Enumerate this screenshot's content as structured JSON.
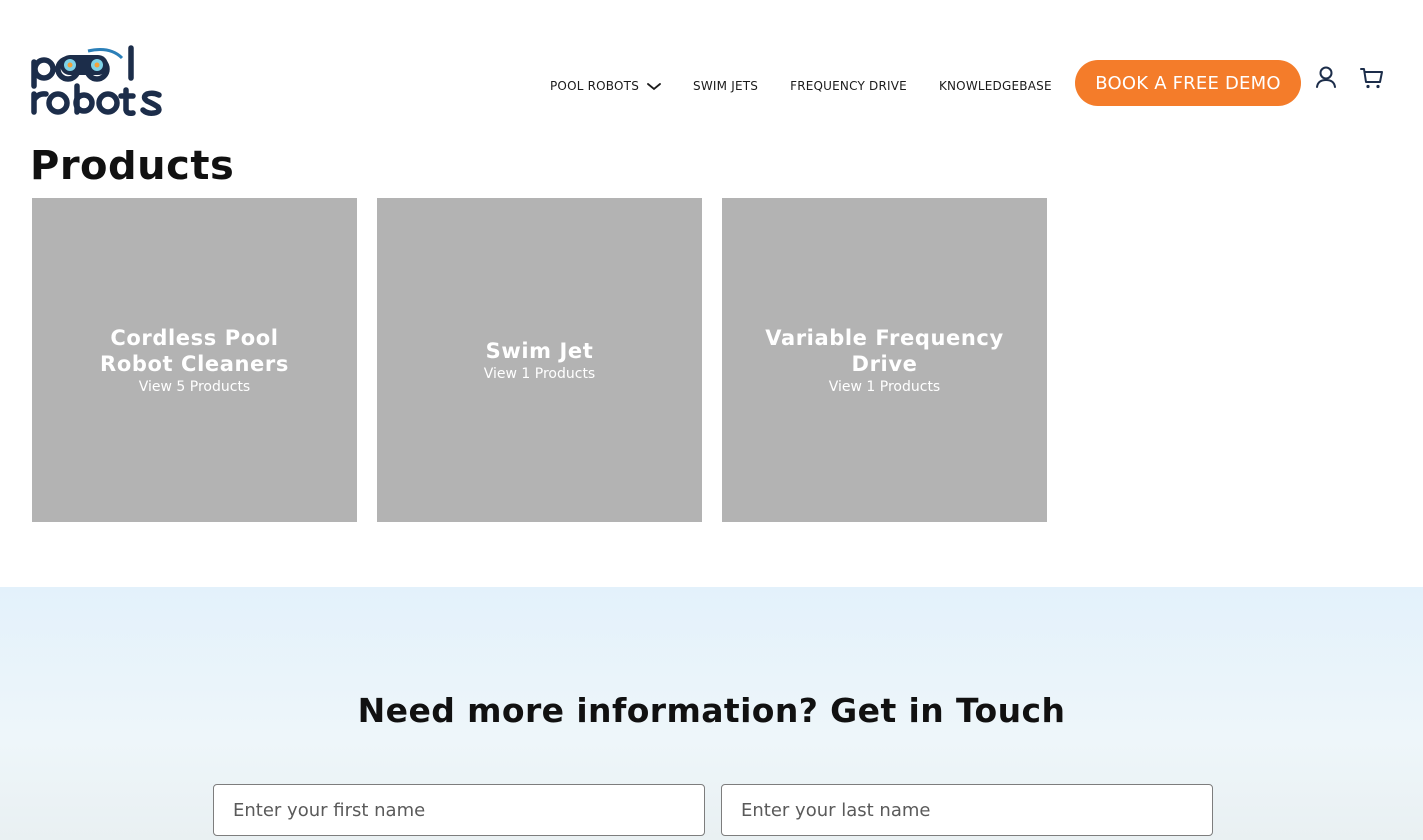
{
  "header": {
    "logo_text": "pool robots",
    "nav": [
      {
        "label": "POOL ROBOTS",
        "has_dropdown": true
      },
      {
        "label": "SWIM JETS"
      },
      {
        "label": "FREQUENCY DRIVE"
      },
      {
        "label": "KNOWLEDGEBASE"
      }
    ],
    "demo_button": "BOOK A FREE DEMO",
    "icons": [
      "account-icon",
      "cart-icon"
    ]
  },
  "page": {
    "title": "Products"
  },
  "categories": [
    {
      "title": "Cordless Pool Robot Cleaners",
      "link": "View 5 Products"
    },
    {
      "title": "Swim Jet",
      "link": "View 1 Products"
    },
    {
      "title": "Variable Frequency Drive",
      "link": "View 1 Products"
    }
  ],
  "contact": {
    "heading": "Need more information? Get in Touch",
    "first_name_placeholder": "Enter your first name",
    "last_name_placeholder": "Enter your last name"
  },
  "colors": {
    "accent": "#f47c2a",
    "brand_navy": "#1c2d4a",
    "card_bg": "#b3b3b3",
    "contact_bg": "#e3f1fb"
  }
}
